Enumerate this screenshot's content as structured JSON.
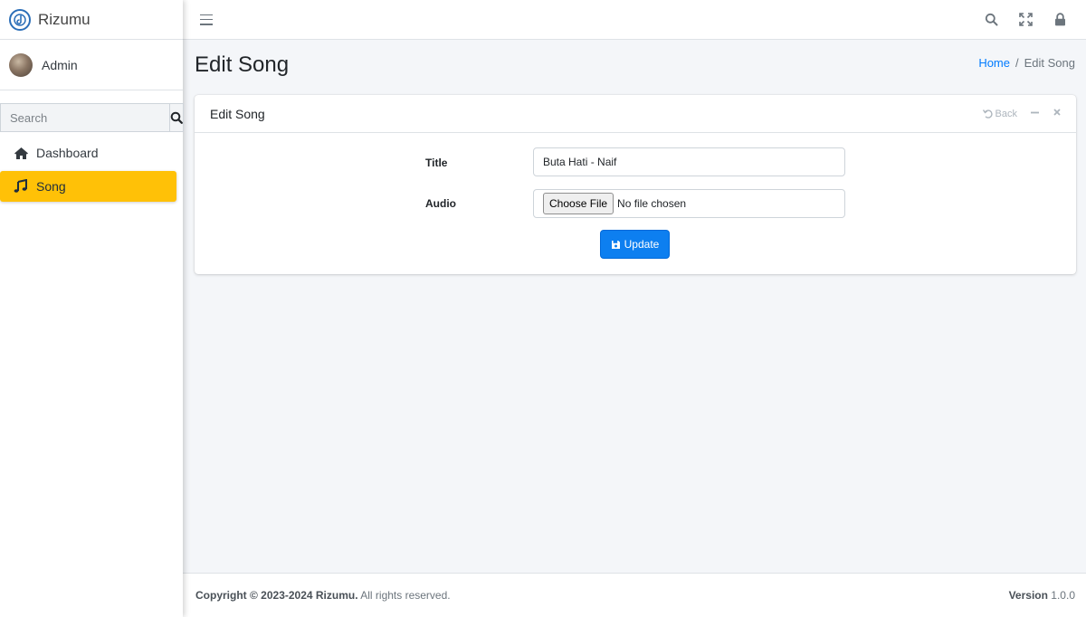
{
  "brand": {
    "name": "Rizumu",
    "logo_icon": "music-disc-icon"
  },
  "user": {
    "name": "Admin"
  },
  "sidebar": {
    "search_placeholder": "Search",
    "items": [
      {
        "label": "Dashboard",
        "icon": "home-icon",
        "active": false
      },
      {
        "label": "Song",
        "icon": "music-icon",
        "active": true
      }
    ]
  },
  "topbar": {
    "icons": [
      "menu-icon",
      "search-icon",
      "fullscreen-icon",
      "lock-icon"
    ]
  },
  "page": {
    "title": "Edit Song",
    "breadcrumb": {
      "home": "Home",
      "separator": "/",
      "current": "Edit Song"
    }
  },
  "card": {
    "title": "Edit Song",
    "back_label": "Back",
    "form": {
      "title_label": "Title",
      "title_value": "Buta Hati - Naif",
      "audio_label": "Audio",
      "choose_file_label": "Choose File",
      "no_file_text": "No file chosen",
      "submit_label": "Update"
    }
  },
  "footer": {
    "copyright_prefix": "Copyright © 2023-2024 Rizumu.",
    "copyright_suffix": "All rights reserved.",
    "version_label": "Version",
    "version_value": "1.0.0"
  },
  "colors": {
    "accent": "#ffc107",
    "primary": "#0d7ff0",
    "link": "#007bff",
    "background": "#f4f6f9"
  }
}
